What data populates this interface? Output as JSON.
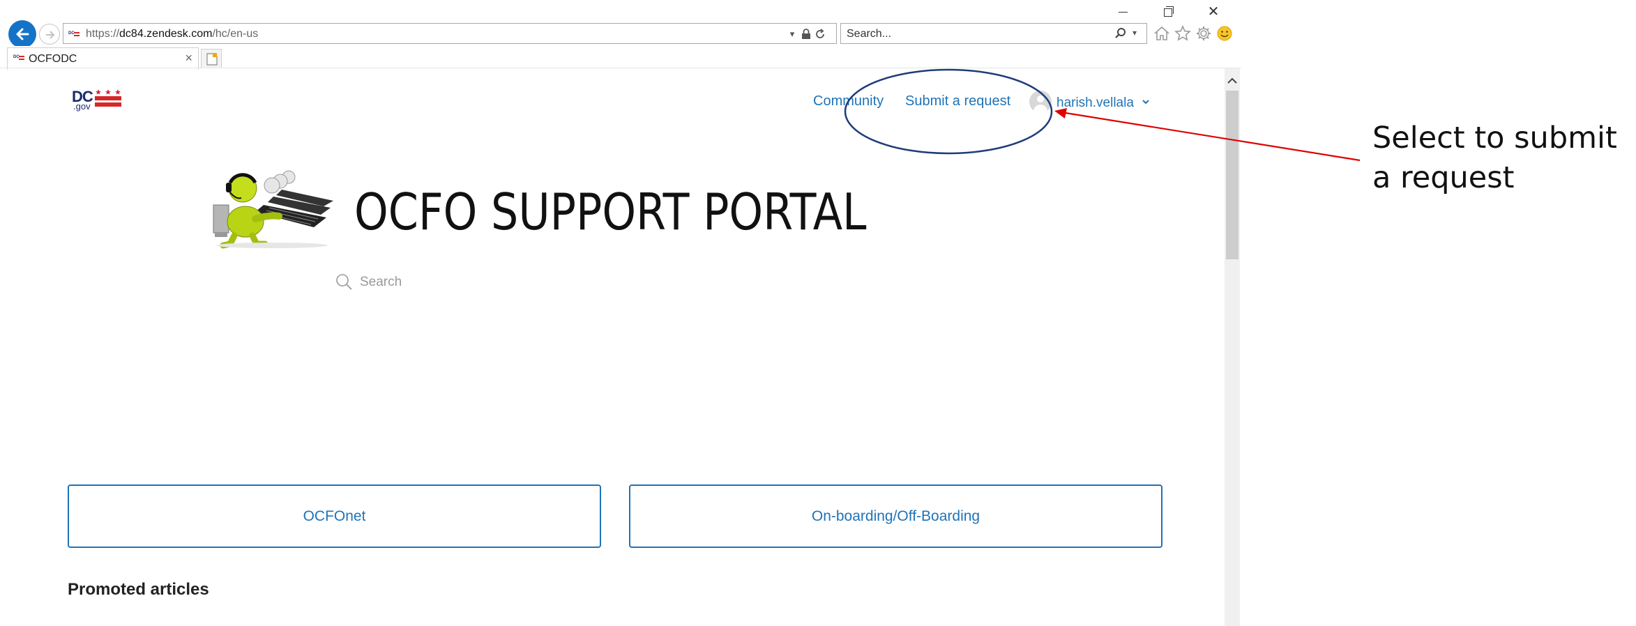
{
  "browser": {
    "url_scheme": "https://",
    "url_domain": "dc84.zendesk.com",
    "url_path": "/hc/en-us",
    "search_placeholder": "Search...",
    "tab_title": "OCFODC",
    "icons": [
      "back-arrow-icon",
      "forward-arrow-icon",
      "lock-icon",
      "refresh-icon",
      "search-icon",
      "home-icon",
      "favorites-star-icon",
      "settings-gear-icon",
      "smiley-feedback-icon"
    ]
  },
  "header": {
    "logo_main": "DC",
    "logo_sub": ".gov",
    "nav": {
      "community": "Community",
      "submit_request": "Submit a request"
    },
    "user_name": "harish.vellala"
  },
  "hero": {
    "title": "OCFO SUPPORT PORTAL",
    "search_placeholder": "Search"
  },
  "blocks": [
    {
      "label": "OCFOnet"
    },
    {
      "label": "On-boarding/Off-Boarding"
    }
  ],
  "promoted": {
    "heading": "Promoted articles"
  },
  "annotation": {
    "text": "Select to submit a request",
    "arrow_color": "#e00000",
    "ellipse_color": "#1e3c78"
  },
  "colors": {
    "link": "#1f73b7",
    "back_button": "#1473c8"
  }
}
